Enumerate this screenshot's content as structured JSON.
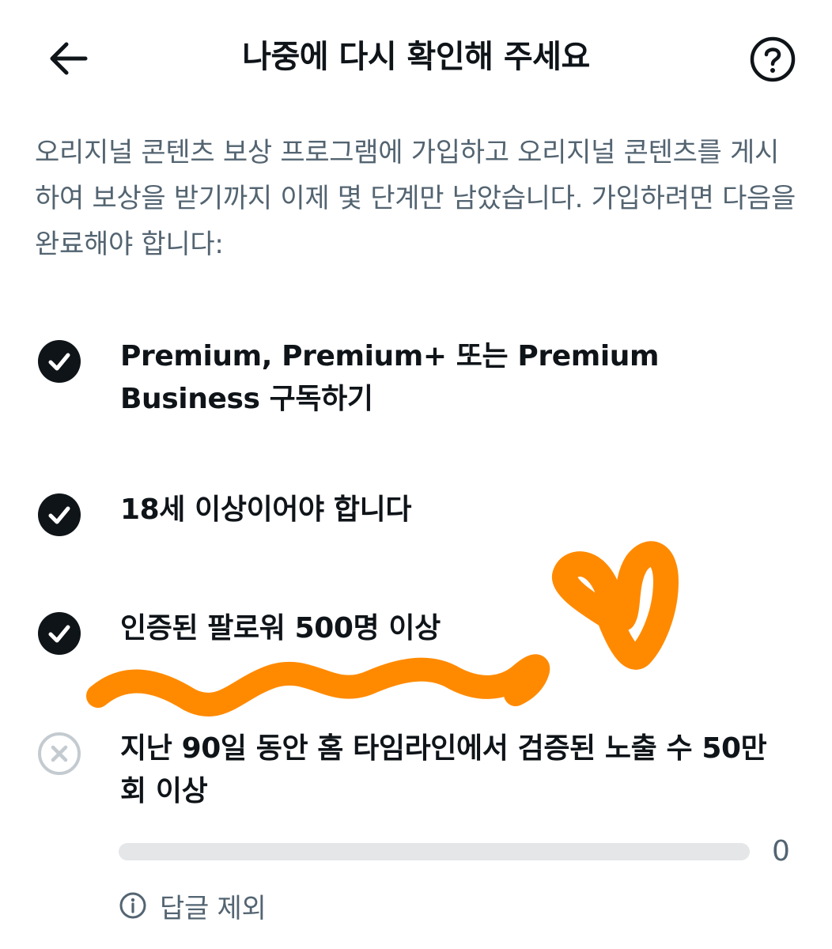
{
  "header": {
    "title": "나중에 다시 확인해 주세요",
    "back_icon": "arrow-left-icon",
    "help_icon": "help-circle-icon"
  },
  "intro_text": "오리지널 콘텐츠 보상 프로그램에 가입하고 오리지널 콘텐츠를 게시하여 보상을 받기까지 이제 몇 단계만 남았습니다. 가입하려면 다음을 완료해야 합니다:",
  "requirements": [
    {
      "label": "Premium, Premium+ 또는 Premium Business 구독하기",
      "status": "complete"
    },
    {
      "label": "18세 이상이어야 합니다",
      "status": "complete"
    },
    {
      "label": "인증된 팔로워 500명 이상",
      "status": "complete"
    },
    {
      "label": "지난 90일 동안 홈 타임라인에서 검증된 노출 수 50만 회 이상",
      "status": "incomplete"
    }
  ],
  "progress": {
    "value_label": "0",
    "fraction": 0
  },
  "note": {
    "icon": "info-icon",
    "text": "답글 제외"
  },
  "colors": {
    "text_primary": "#0f1419",
    "text_secondary": "#536471",
    "check_fill": "#0f1419",
    "incomplete_icon": "#c4cbd0",
    "progress_track": "#e4e6e8",
    "scribble": "#ff8a00"
  }
}
